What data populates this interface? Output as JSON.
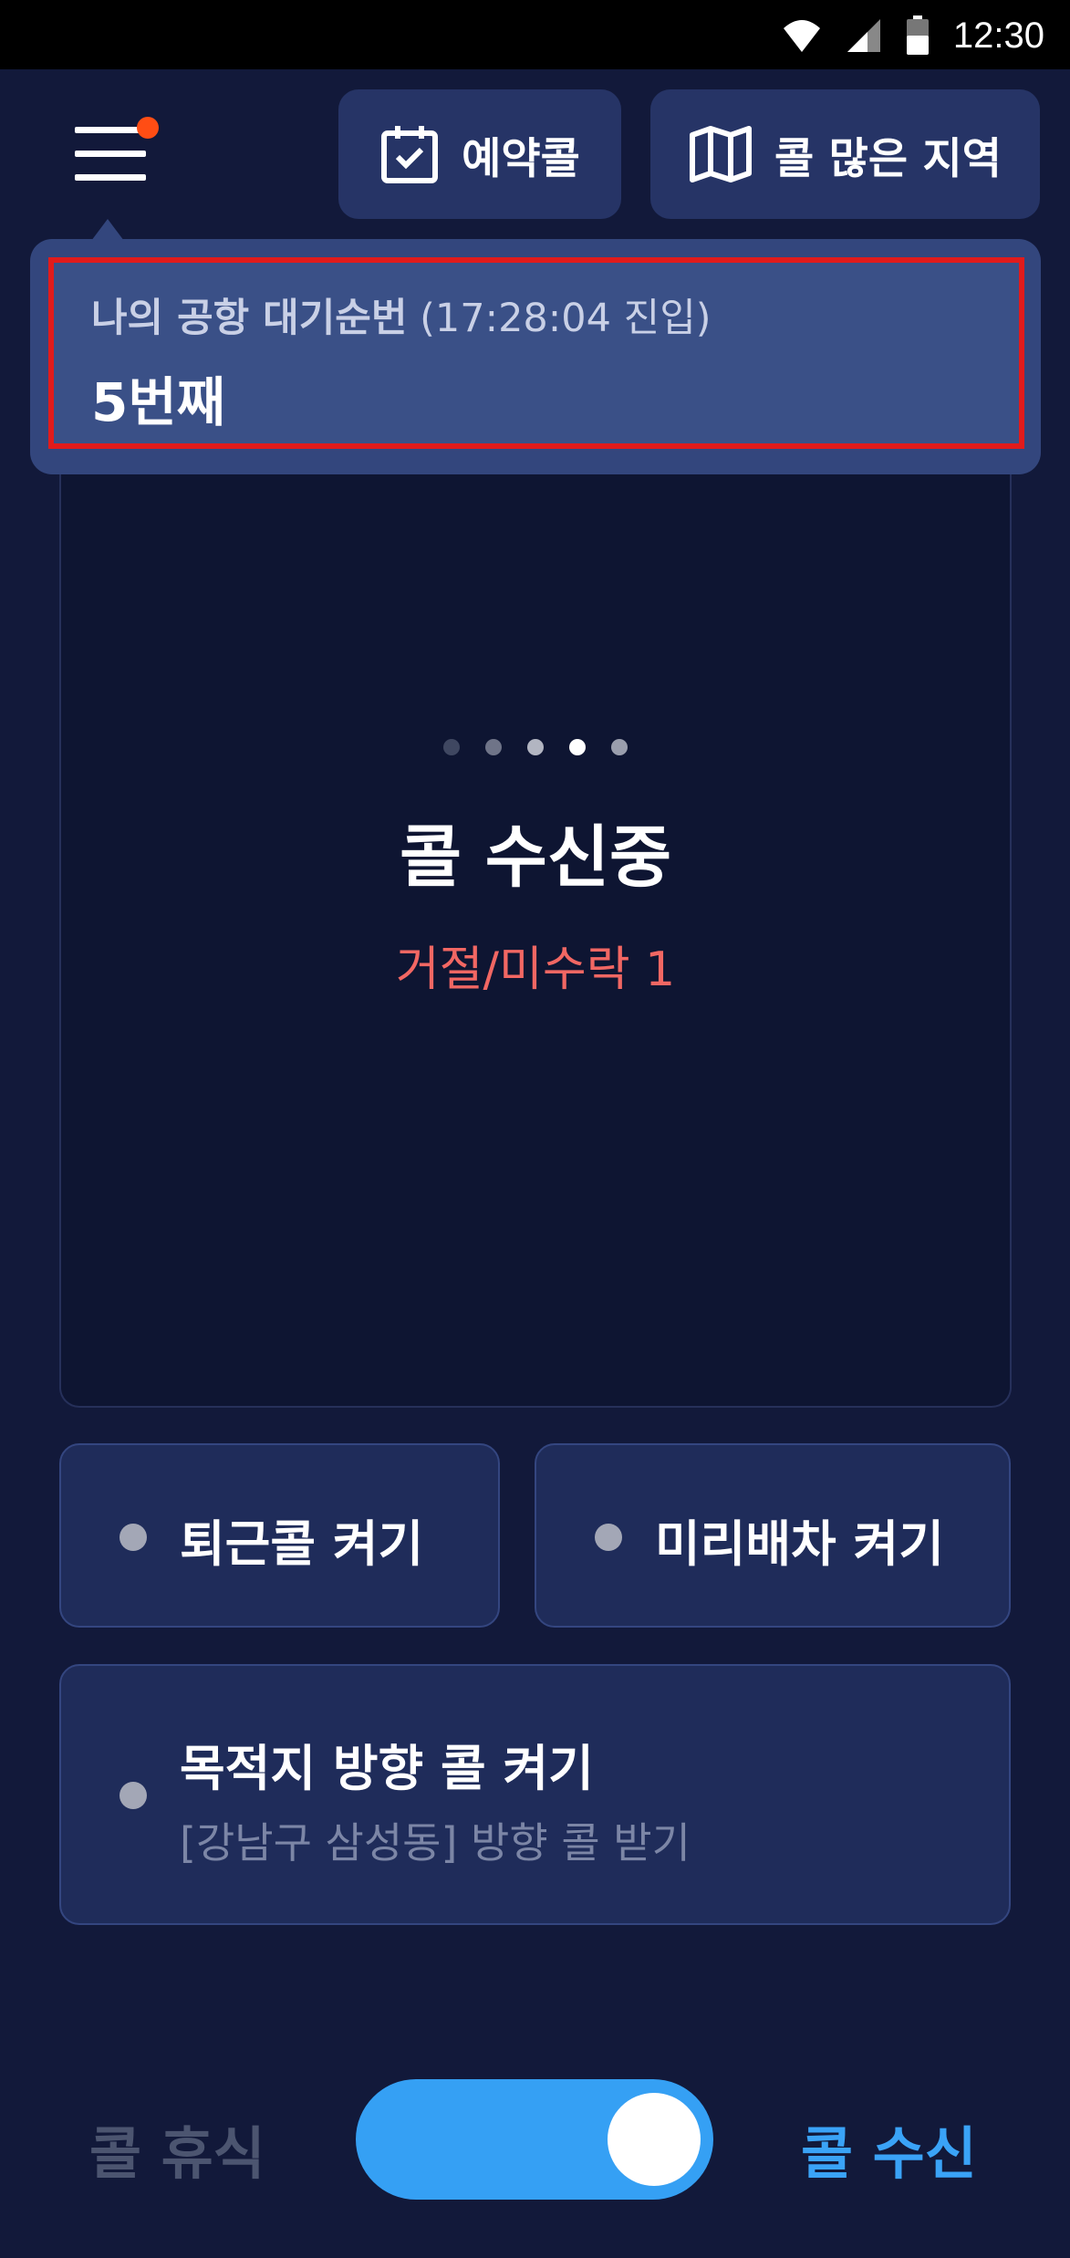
{
  "statusbar": {
    "time": "12:30",
    "icons": [
      "wifi-icon",
      "cell-signal-icon",
      "battery-icon"
    ]
  },
  "header": {
    "menu_icon": "hamburger-menu-icon",
    "menu_badge_color": "#ff4d14",
    "reservation_label": "예약콜",
    "reservation_icon": "calendar-check-icon",
    "hotzone_label": "콜 많은 지역",
    "hotzone_icon": "map-icon"
  },
  "queue": {
    "title_bold": "나의 공항 대기순번",
    "title_time": "(17:28:04 진입)",
    "rank": "5번째"
  },
  "call_panel": {
    "title": "콜 수신중",
    "reject_text": "거절/미수락 1",
    "dots_total": 5,
    "dots_active_index": 3
  },
  "options": {
    "commute_label": "퇴근콜 켜기",
    "predispatch_label": "미리배차 켜기",
    "destination_title": "목적지 방향 콜 켜기",
    "destination_sub": "[강남구 삼성동] 방향 콜 받기"
  },
  "bottom": {
    "rest_label": "콜 휴식",
    "receive_label": "콜 수신",
    "toggle_on": true,
    "accent_color": "#35a0f4"
  }
}
